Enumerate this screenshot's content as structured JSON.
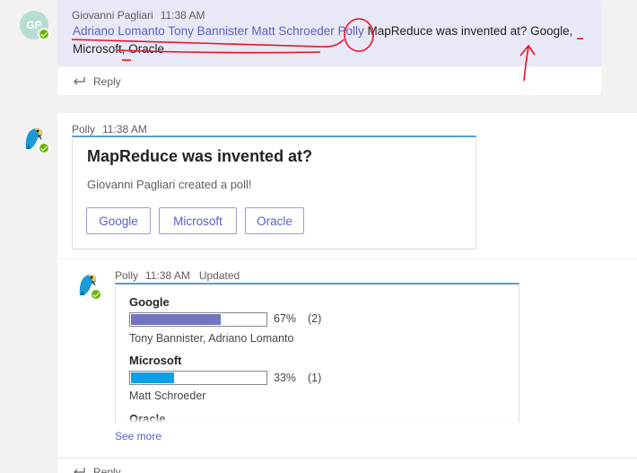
{
  "message1": {
    "avatar_initials": "GP",
    "sender": "Giovanni Pagliari",
    "time": "11:38 AM",
    "mentions": [
      "Adriano Lomanto",
      "Tony Bannister",
      "Matt Schroeder",
      "Polly"
    ],
    "text_after_mentions": "MapReduce was invented at? Google,",
    "text_line2": "Microsoft, Oracle",
    "reply_label": "Reply"
  },
  "poll_message": {
    "sender": "Polly",
    "time": "11:38 AM",
    "question": "MapReduce was invented at?",
    "subtitle": "Giovanni Pagliari created a poll!",
    "options": [
      "Google",
      "Microsoft",
      "Oracle"
    ]
  },
  "results_message": {
    "sender": "Polly",
    "time": "11:38 AM",
    "status": "Updated",
    "results": [
      {
        "option": "Google",
        "percent_label": "67%",
        "count_label": "(2)",
        "fraction": 0.67,
        "color": "#7175bd",
        "voters": "Tony Bannister, Adriano Lomanto"
      },
      {
        "option": "Microsoft",
        "percent_label": "33%",
        "count_label": "(1)",
        "fraction": 0.33,
        "color": "#0ea0e6",
        "voters": "Matt Schroeder"
      },
      {
        "option": "Oracle"
      }
    ],
    "see_more": "See more",
    "reply_label": "Reply"
  },
  "colors": {
    "mention": "#5b5fc7",
    "annotation_red": "#e81123",
    "presence_green": "#6bb700",
    "card_accent": "#5b9bd5"
  },
  "icons": [
    "reply-arrow-icon",
    "parrot-bot-icon",
    "presence-available-icon"
  ]
}
